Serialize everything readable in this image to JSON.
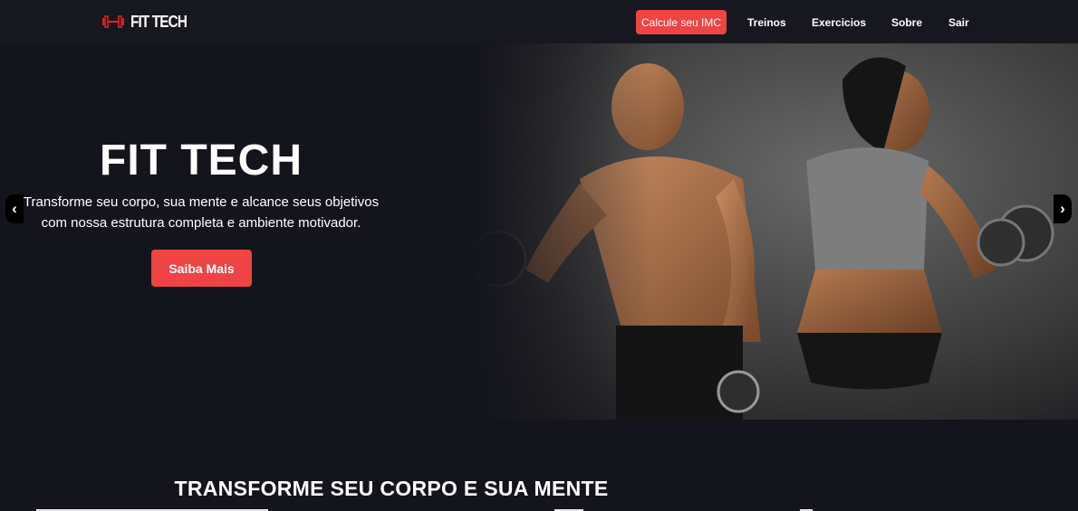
{
  "navbar": {
    "brand": "FIT TECH",
    "brand_icon": "dumbbell-icon",
    "cta_label": "Calcule seu IMC",
    "links": [
      "Treinos",
      "Exercicios",
      "Sobre",
      "Sair"
    ]
  },
  "hero": {
    "title": "FIT TECH",
    "subtitle": "Transforme seu corpo, sua mente e alcance seus objetivos com nossa estrutura completa e ambiente motivador.",
    "button_label": "Saiba Mais",
    "prev_icon": "chevron-left-icon",
    "next_icon": "chevron-right-icon",
    "prev_glyph": "‹",
    "next_glyph": "›"
  },
  "section": {
    "title": "TRANSFORME SEU CORPO E SUA MENTE"
  },
  "colors": {
    "accent": "#ee4444",
    "background": "#14151c",
    "navbar": "#17181f"
  }
}
